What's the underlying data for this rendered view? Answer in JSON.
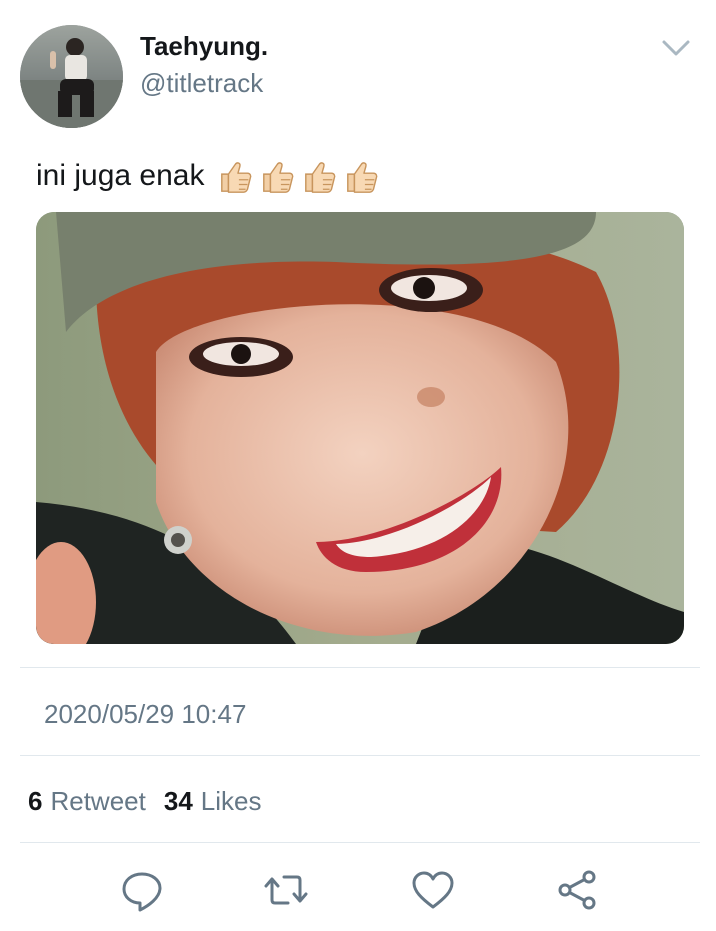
{
  "tweet": {
    "author_name": "Taehyung.",
    "author_handle": "@titletrack",
    "text": "ini juga enak",
    "emoji_icon": "thumbs-up-icon",
    "timestamp": "2020/05/29 10:47",
    "retweets_count": "6",
    "retweets_label": "Retweet",
    "likes_count": "34",
    "likes_label": "Likes"
  },
  "actions": [
    {
      "icon": "reply-icon"
    },
    {
      "icon": "retweet-icon"
    },
    {
      "icon": "like-icon"
    },
    {
      "icon": "share-icon"
    }
  ],
  "colors": {
    "text": "#14171a",
    "secondary": "#657786",
    "divider": "#e1e8ed"
  }
}
